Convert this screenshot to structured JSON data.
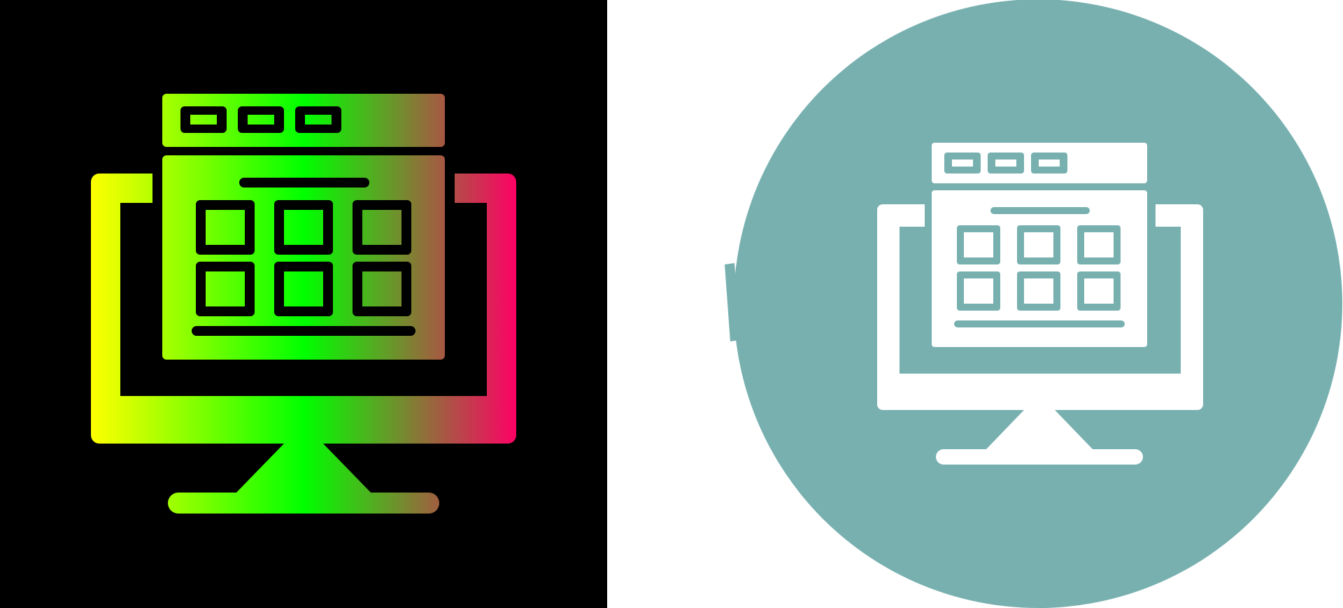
{
  "image": {
    "description_icon": "monitor-with-web-page-grid-icon",
    "variants": [
      {
        "id": "gradient",
        "background": "#000000",
        "gradient_stops": [
          "#FFFF00",
          "#00FF00",
          "#FF0066"
        ]
      },
      {
        "id": "glyph-circle",
        "background": "#FFFFFF",
        "circle_color": "#78B0B0",
        "glyph_color": "#FFFFFF"
      }
    ]
  }
}
